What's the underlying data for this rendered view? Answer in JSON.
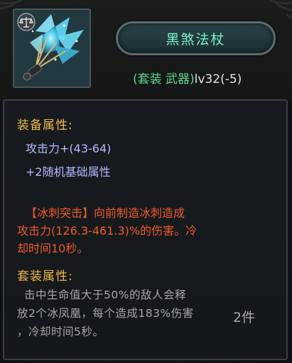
{
  "item": {
    "name": "黑煞法杖",
    "set_tag": "(套装 武器)",
    "level": "lv32(-5)",
    "icon": "ice-fan-weapon-icon",
    "set_badge_icon": "balance-scale-icon"
  },
  "attributes": {
    "title": "装备属性:",
    "lines": [
      "攻击力+(43-64)",
      "+2随机基础属性"
    ]
  },
  "skill": {
    "line1": "【冰刺突击】向前制造冰刺造成",
    "line2": "攻击力(126.3-461.3)%的伤害。冷",
    "line3": "却时间10秒。"
  },
  "set_bonus": {
    "title": "套装属性:",
    "line1": "击中生命值大于50%的敌人会释",
    "line2": "放2个冰凤凰，每个造成183%伤害",
    "line3": "，冷却时间5秒。",
    "pieces": "2件"
  },
  "colors": {
    "name": "#7cf2c6",
    "set_tag": "#5fd98c",
    "section_title": "#f0b84a",
    "stat": "#b7b8ff",
    "skill": "#f05a2a",
    "set_desc": "#a7a7a7"
  }
}
